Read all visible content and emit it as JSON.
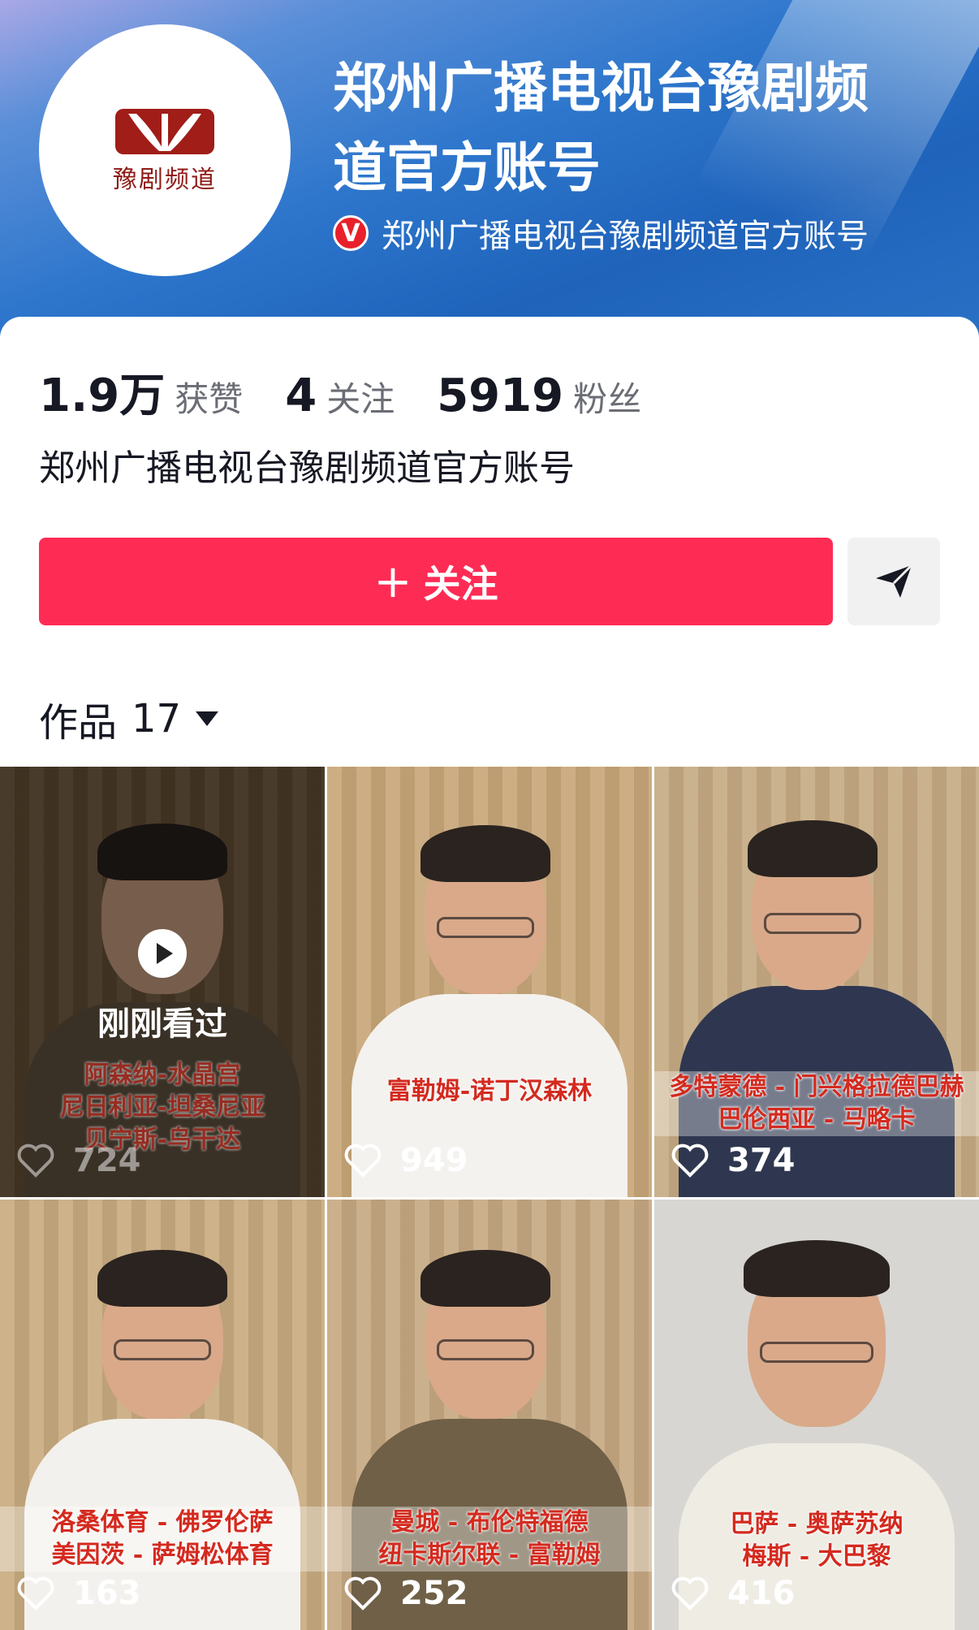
{
  "profile": {
    "name": "郑州广播电视台豫剧频道官方账号",
    "verified_text": "郑州广播电视台豫剧频道官方账号",
    "avatar_text": "豫剧频道",
    "bio": "郑州广播电视台豫剧频道官方账号"
  },
  "stats": [
    {
      "num": "1.9万",
      "label": "获赞"
    },
    {
      "num": "4",
      "label": "关注"
    },
    {
      "num": "5919",
      "label": "粉丝"
    }
  ],
  "actions": {
    "follow_label": "关注",
    "share_icon": "send-icon"
  },
  "works": {
    "label": "作品",
    "count": "17"
  },
  "videos": [
    {
      "caption": [
        "阿森纳-水晶宫",
        "尼日利亚-坦桑尼亚",
        "贝宁斯-乌干达"
      ],
      "likes": "724",
      "recent": "刚刚看过"
    },
    {
      "caption": [
        "富勒姆-诺丁汉森林"
      ],
      "likes": "949"
    },
    {
      "caption": [
        "多特蒙德 - 门兴格拉德巴赫",
        "巴伦西亚 - 马略卡"
      ],
      "likes": "374"
    },
    {
      "caption": [
        "洛桑体育 - 佛罗伦萨",
        "美因茨 - 萨姆松体育"
      ],
      "likes": "163"
    },
    {
      "caption": [
        "曼城 - 布伦特福德",
        "纽卡斯尔联 - 富勒姆"
      ],
      "likes": "252"
    },
    {
      "caption": [
        "巴萨 - 奥萨苏纳",
        "梅斯 - 大巴黎"
      ],
      "likes": "416"
    }
  ],
  "colors": {
    "follow": "#fe2c55",
    "header": "#1f63bb",
    "caption": "#d42a1f"
  }
}
